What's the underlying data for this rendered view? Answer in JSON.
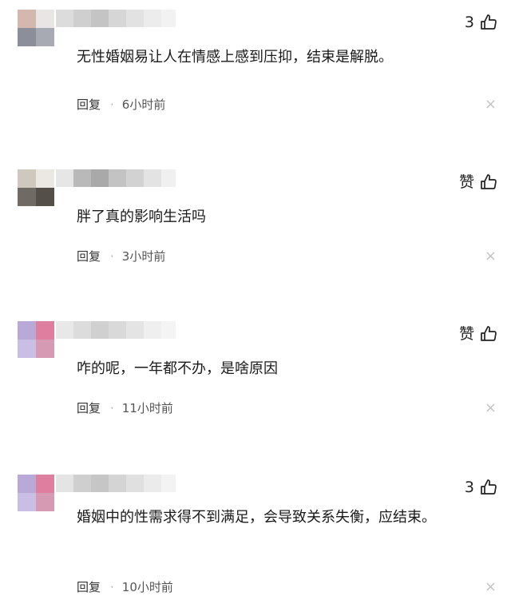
{
  "comments": [
    {
      "like_label": "3",
      "text": "无性婚姻易让人在情感上感到压抑，结束是解脱。",
      "reply_label": "回复",
      "separator": "·",
      "time": "6小时前",
      "close_glyph": "×",
      "avatar_colors": [
        "#d4b7ae",
        "#e8e6e4",
        "#8c8f99",
        "#a7aab3"
      ],
      "name_colors": [
        "#dcdcdc",
        "#cfcfcf",
        "#c4c4c4",
        "#d6d6d6",
        "#e2e2e2",
        "#ececec",
        "#f2f2f2"
      ]
    },
    {
      "like_label": "赞",
      "text": "胖了真的影响生活吗",
      "reply_label": "回复",
      "separator": "·",
      "time": "3小时前",
      "close_glyph": "×",
      "avatar_colors": [
        "#cfc8bf",
        "#ebe7e2",
        "#6f6a63",
        "#544f48"
      ],
      "name_colors": [
        "#e6e6e6",
        "#b9b9b9",
        "#a9a9a9",
        "#c3c3c3",
        "#d2d2d2",
        "#e3e3e3",
        "#f0f0f0"
      ]
    },
    {
      "like_label": "赞",
      "text": "咋的呢，一年都不办，是啥原因",
      "reply_label": "回复",
      "separator": "·",
      "time": "11小时前",
      "close_glyph": "×",
      "avatar_colors": [
        "#b8a9d6",
        "#df7fa0",
        "#c9bee4",
        "#d79ab3"
      ],
      "name_colors": [
        "#e8e8e8",
        "#dcdcdc",
        "#d0d0d0",
        "#d9d9d9",
        "#e4e4e4",
        "#efefef",
        "#f4f4f4"
      ]
    },
    {
      "like_label": "3",
      "text": "婚姻中的性需求得不到满足，会导致关系失衡，应结束。",
      "reply_label": "回复",
      "separator": "·",
      "time": "10小时前",
      "close_glyph": "×",
      "avatar_colors": [
        "#b8a9d6",
        "#df7fa0",
        "#c9bee4",
        "#d79ab3"
      ],
      "name_colors": [
        "#e4e4e4",
        "#cfcfcf",
        "#c6c6c6",
        "#d4d4d4",
        "#e0e0e0",
        "#ebebeb",
        "#f3f3f3"
      ]
    }
  ]
}
